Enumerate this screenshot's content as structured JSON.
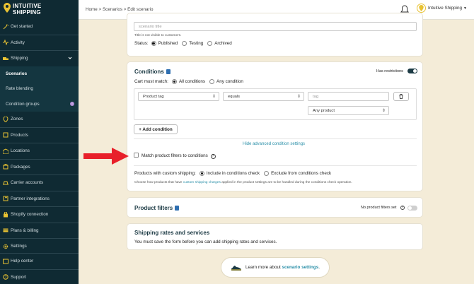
{
  "brand": {
    "line1": "INTUITIVE",
    "line2": "SHIPPING",
    "accent": "#e8c233",
    "sidebar_bg": "#0f2a33"
  },
  "sidebar": {
    "items": [
      {
        "label": "Get started",
        "icon": "wand-icon"
      },
      {
        "label": "Activity",
        "icon": "pulse-icon"
      },
      {
        "label": "Shipping",
        "icon": "truck-icon",
        "expanded": true
      },
      {
        "label": "Scenarios",
        "sub": true,
        "active": true
      },
      {
        "label": "Rate blending",
        "sub": true
      },
      {
        "label": "Condition groups",
        "sub": true,
        "badge": "i"
      },
      {
        "label": "Zones",
        "icon": "pin-icon"
      },
      {
        "label": "Products",
        "icon": "box-icon"
      },
      {
        "label": "Locations",
        "icon": "warehouse-icon"
      },
      {
        "label": "Packages",
        "icon": "package-icon"
      },
      {
        "label": "Carrier accounts",
        "icon": "carrier-icon"
      },
      {
        "label": "Partner integrations",
        "icon": "puzzle-icon"
      },
      {
        "label": "Shopify connection",
        "icon": "bag-icon"
      },
      {
        "label": "Plans & billing",
        "icon": "card-icon"
      },
      {
        "label": "Settings",
        "icon": "gear-icon"
      }
    ],
    "bottom": [
      {
        "label": "Help center",
        "icon": "help-icon"
      },
      {
        "label": "Support",
        "icon": "support-icon"
      }
    ]
  },
  "topbar": {
    "breadcrumb": "Home > Scenarios > Edit scenario",
    "account": "Intuitive Shipping"
  },
  "scenario": {
    "title_placeholder": "scenario title",
    "title_hint": "Title is not visible to customers.",
    "status_label": "Status:",
    "statuses": [
      "Published",
      "Testing",
      "Archived"
    ],
    "selected_status": "Published"
  },
  "conditions": {
    "heading": "Conditions",
    "restrictions_label": "Has restrictions",
    "cart_must_match_label": "Cart must match:",
    "match_options": [
      "All conditions",
      "Any condition"
    ],
    "field": "Product tag",
    "operator": "equals",
    "value_placeholder": "tag",
    "scope": "Any product",
    "add_condition": "+ Add condition",
    "advanced_link": "Hide advanced condition settings",
    "match_filters_label": "Match product filters to conditions",
    "custom_shipping_label": "Products with custom shipping:",
    "custom_options": [
      "Include in conditions check",
      "Exclude from conditions check"
    ],
    "custom_note_pre": "Choose how products that have",
    "custom_note_link": "custom shipping charges",
    "custom_note_post": "applied in the product settings are to be handled during the conditions check operation."
  },
  "product_filters": {
    "heading": "Product filters",
    "status": "No product filters set"
  },
  "shipping_rates": {
    "heading": "Shipping rates and services",
    "note": "You must save the form before you can add shipping rates and services."
  },
  "learn": {
    "pre": "Learn more about",
    "link": "scenario settings",
    "post": "."
  }
}
